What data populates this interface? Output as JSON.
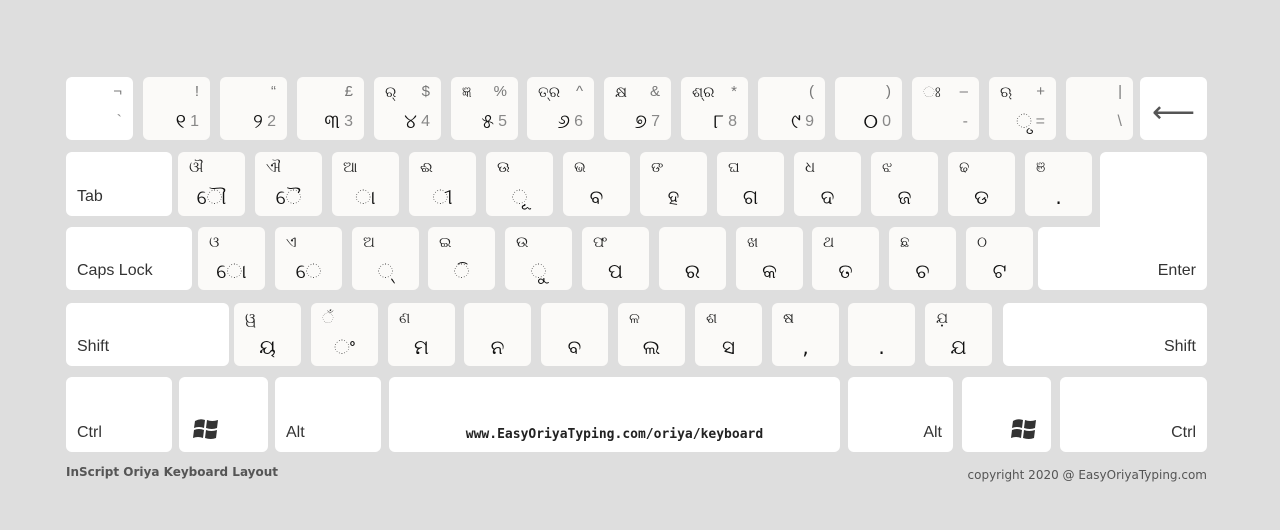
{
  "colors": {
    "background": "#dedede",
    "key": "#fbfaf8",
    "modifier_key": "#ffffff",
    "text": "#222222"
  },
  "rows": [
    [
      {
        "id": "backtick",
        "tr": "¬",
        "br": "`",
        "type": "num"
      },
      {
        "id": "1",
        "tr": "!",
        "bm": "୧",
        "br": "1",
        "type": "num"
      },
      {
        "id": "2",
        "tr": "“",
        "bm": "୨",
        "br": "2",
        "type": "num"
      },
      {
        "id": "3",
        "tr": "£",
        "bm": "୩",
        "br": "3",
        "type": "num"
      },
      {
        "id": "4",
        "tl": "ର୍",
        "tr": "$",
        "bm": "୪",
        "br": "4",
        "type": "num"
      },
      {
        "id": "5",
        "tl": "ଜ୍ଞ",
        "tr": "%",
        "bm": "୫",
        "br": "5",
        "type": "num"
      },
      {
        "id": "6",
        "tl": "ତ୍ର",
        "tr": "^",
        "bm": "୬",
        "br": "6",
        "type": "num"
      },
      {
        "id": "7",
        "tl": "କ୍ଷ",
        "tr": "&",
        "bm": "୭",
        "br": "7",
        "type": "num"
      },
      {
        "id": "8",
        "tl": "ଶ୍ର",
        "tr": "*",
        "bm": "୮",
        "br": "8",
        "type": "num"
      },
      {
        "id": "9",
        "tr": "(",
        "bm": "୯",
        "br": "9",
        "type": "num"
      },
      {
        "id": "0",
        "tr": ")",
        "bm": "୦",
        "br": "0",
        "type": "num"
      },
      {
        "id": "minus",
        "tl": "ଃ",
        "tr": "–",
        "br": "-",
        "type": "num"
      },
      {
        "id": "equals",
        "tl": "ଋ",
        "tr": "+",
        "bm": "ୃ",
        "br": "=",
        "type": "num"
      },
      {
        "id": "backslash",
        "tr": "|",
        "br": "\\",
        "type": "num"
      },
      {
        "id": "backspace",
        "icon": "left-arrow",
        "label": "⟵",
        "type": "backspace"
      }
    ],
    [
      {
        "id": "tab",
        "ml": "Tab",
        "type": "mod"
      },
      {
        "id": "q",
        "tl": "ଔ",
        "bm": "ୌ"
      },
      {
        "id": "w",
        "tl": "ଐ",
        "bm": "ୈ"
      },
      {
        "id": "e",
        "tl": "ଆ",
        "bm": "ା"
      },
      {
        "id": "r",
        "tl": "ଈ",
        "bm": "ୀ"
      },
      {
        "id": "t",
        "tl": "ଊ",
        "bm": "ୂ"
      },
      {
        "id": "y",
        "tl": "ଭ",
        "bm": "ବ"
      },
      {
        "id": "u",
        "tl": "ଙ",
        "bm": "ହ"
      },
      {
        "id": "i",
        "tl": "ଘ",
        "bm": "ଗ"
      },
      {
        "id": "o",
        "tl": "ଧ",
        "bm": "ଦ"
      },
      {
        "id": "p",
        "tl": "ଝ",
        "bm": "ଜ"
      },
      {
        "id": "bracket-left",
        "tl": "ଢ",
        "bm": "ଡ"
      },
      {
        "id": "bracket-right",
        "tl": "ଞ",
        "bm": "."
      }
    ],
    [
      {
        "id": "caps-lock",
        "ml": "Caps Lock",
        "type": "mod"
      },
      {
        "id": "a",
        "tl": "ଓ",
        "bm": "ୋ"
      },
      {
        "id": "s",
        "tl": "ଏ",
        "bm": "େ"
      },
      {
        "id": "d",
        "tl": "ଅ",
        "bm": "୍"
      },
      {
        "id": "f",
        "tl": "ଇ",
        "bm": "ି"
      },
      {
        "id": "g",
        "tl": "ଉ",
        "bm": "ୁ"
      },
      {
        "id": "h",
        "tl": "ଫ",
        "bm": "ପ"
      },
      {
        "id": "j",
        "bm": "ର"
      },
      {
        "id": "k",
        "tl": "ଖ",
        "bm": "କ"
      },
      {
        "id": "l",
        "tl": "ଥ",
        "bm": "ତ"
      },
      {
        "id": "semicolon",
        "tl": "ଛ",
        "bm": "ଚ"
      },
      {
        "id": "quote",
        "tl": "ଠ",
        "bm": "ଟ"
      },
      {
        "id": "enter",
        "mr": "Enter",
        "type": "mod"
      }
    ],
    [
      {
        "id": "shift-left",
        "ml": "Shift",
        "type": "mod"
      },
      {
        "id": "z",
        "tl": "ୱ",
        "bm": "ୟ"
      },
      {
        "id": "x",
        "tl": "ଁ",
        "bm": "ଂ"
      },
      {
        "id": "c",
        "tl": "ଣ",
        "bm": "ମ"
      },
      {
        "id": "v",
        "bm": "ନ"
      },
      {
        "id": "b",
        "bm": "ବ"
      },
      {
        "id": "n",
        "tl": "ଳ",
        "bm": "ଲ"
      },
      {
        "id": "m",
        "tl": "ଶ",
        "bm": "ସ"
      },
      {
        "id": "comma",
        "tl": "ଷ",
        "bm": ","
      },
      {
        "id": "period",
        "bm": "."
      },
      {
        "id": "slash",
        "tl": "ଯ଼",
        "bm": "ଯ"
      },
      {
        "id": "shift-right",
        "mr": "Shift",
        "type": "mod"
      }
    ],
    [
      {
        "id": "ctrl-left",
        "ml": "Ctrl",
        "type": "mod"
      },
      {
        "id": "win-left",
        "icon": "windows-logo",
        "type": "win"
      },
      {
        "id": "alt-left",
        "ml": "Alt",
        "type": "mod"
      },
      {
        "id": "space",
        "space": "www.EasyOriyaTyping.com/oriya/keyboard",
        "type": "mod"
      },
      {
        "id": "alt-right",
        "mr": "Alt",
        "type": "mod"
      },
      {
        "id": "win-right",
        "icon": "windows-logo",
        "type": "win-right"
      },
      {
        "id": "ctrl-right",
        "mr": "Ctrl",
        "type": "mod"
      }
    ]
  ],
  "footer": {
    "title": "InScript Oriya Keyboard Layout",
    "copyright": "copyright 2020 @ EasyOriyaTyping.com"
  }
}
